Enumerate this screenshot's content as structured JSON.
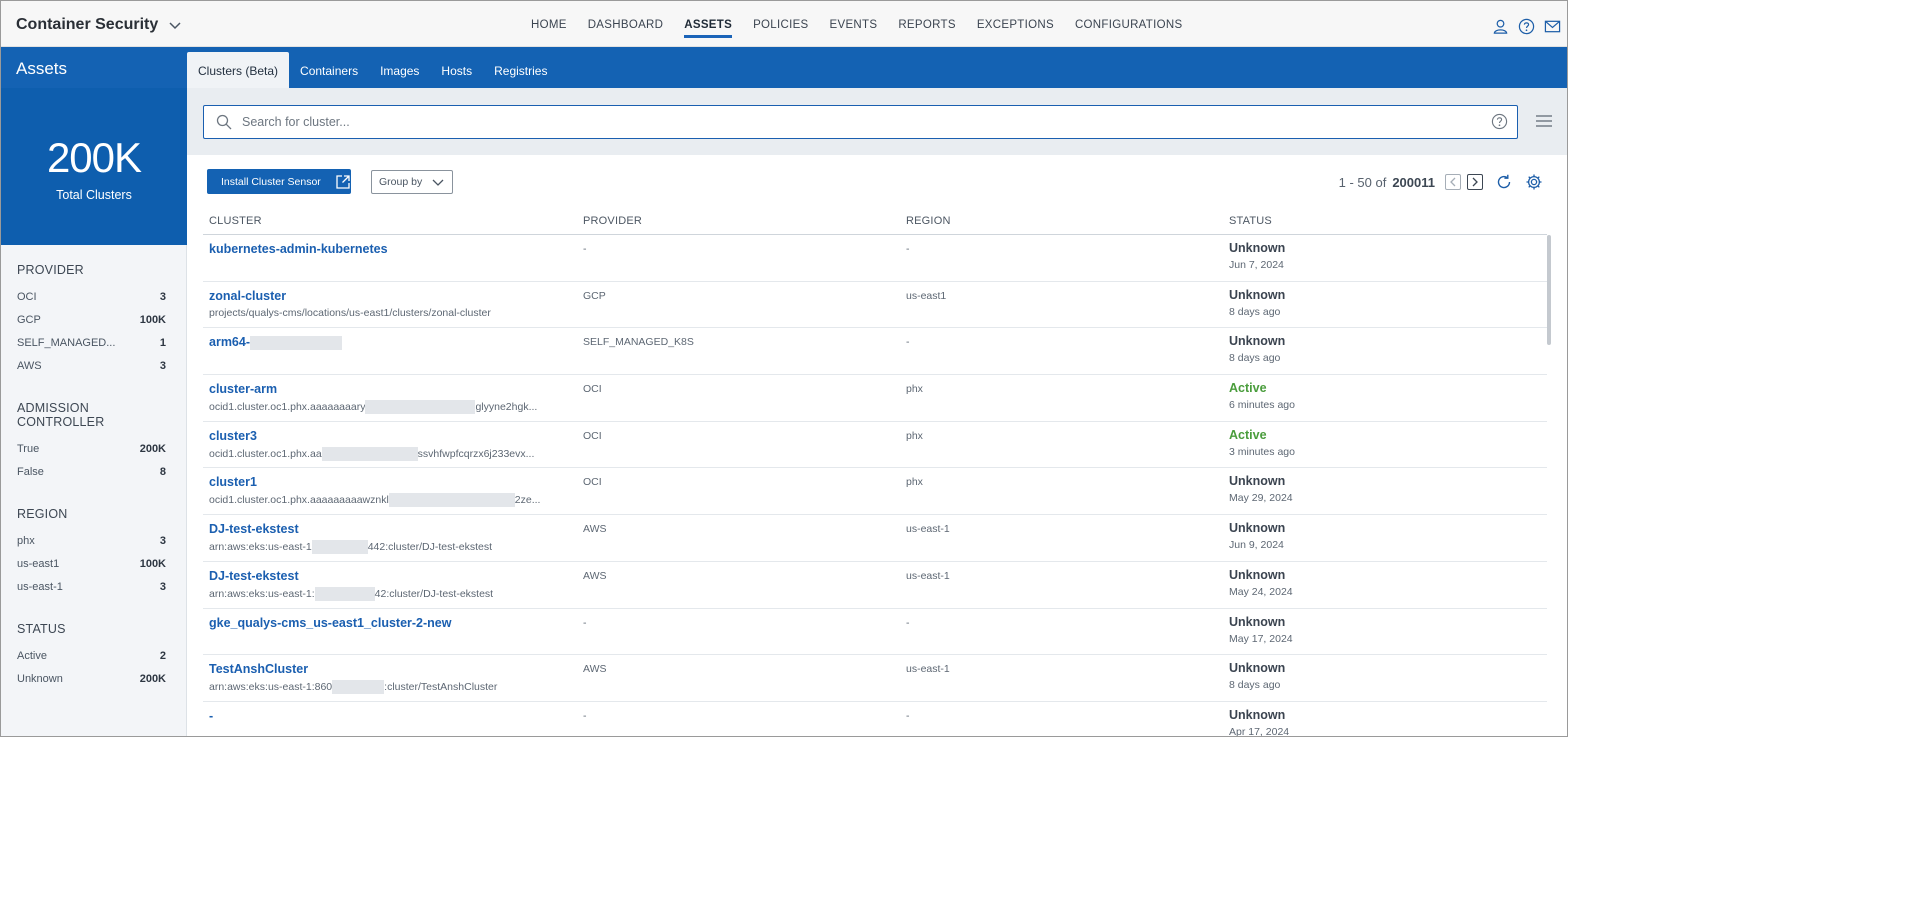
{
  "app": {
    "title": "Container Security"
  },
  "nav": {
    "items": [
      {
        "label": "HOME",
        "active": false
      },
      {
        "label": "DASHBOARD",
        "active": false
      },
      {
        "label": "ASSETS",
        "active": true
      },
      {
        "label": "POLICIES",
        "active": false
      },
      {
        "label": "EVENTS",
        "active": false
      },
      {
        "label": "REPORTS",
        "active": false
      },
      {
        "label": "EXCEPTIONS",
        "active": false
      },
      {
        "label": "CONFIGURATIONS",
        "active": false
      }
    ]
  },
  "section": {
    "title": "Assets"
  },
  "subtabs": [
    {
      "label": "Clusters (Beta)",
      "active": true
    },
    {
      "label": "Containers",
      "active": false
    },
    {
      "label": "Images",
      "active": false
    },
    {
      "label": "Hosts",
      "active": false
    },
    {
      "label": "Registries",
      "active": false
    }
  ],
  "summary": {
    "total": "200K",
    "label": "Total Clusters"
  },
  "facets": [
    {
      "title": "PROVIDER",
      "rows": [
        {
          "label": "OCI",
          "count": "3"
        },
        {
          "label": "GCP",
          "count": "100K"
        },
        {
          "label": "SELF_MANAGED...",
          "count": "1"
        },
        {
          "label": "AWS",
          "count": "3"
        }
      ]
    },
    {
      "title": "ADMISSION CONTROLLER",
      "rows": [
        {
          "label": "True",
          "count": "200K"
        },
        {
          "label": "False",
          "count": "8"
        }
      ]
    },
    {
      "title": "REGION",
      "rows": [
        {
          "label": "phx",
          "count": "3"
        },
        {
          "label": "us-east1",
          "count": "100K"
        },
        {
          "label": "us-east-1",
          "count": "3"
        }
      ]
    },
    {
      "title": "STATUS",
      "rows": [
        {
          "label": "Active",
          "count": "2"
        },
        {
          "label": "Unknown",
          "count": "200K"
        }
      ]
    }
  ],
  "search": {
    "placeholder": "Search for cluster..."
  },
  "toolbar": {
    "install_label": "Install Cluster Sensor",
    "group_label": "Group by"
  },
  "pager": {
    "range": "1 - 50 of",
    "total": "200011"
  },
  "table": {
    "columns": {
      "cluster": "CLUSTER",
      "provider": "PROVIDER",
      "region": "REGION",
      "status": "STATUS"
    },
    "rows": [
      {
        "name": "kubernetes-admin-kubernetes",
        "sub": [],
        "provider": "-",
        "region": "-",
        "status": "Unknown",
        "status_active": false,
        "time": "Jun 7, 2024"
      },
      {
        "name": "zonal-cluster",
        "sub": [
          "projects/qualys-cms/locations/us-east1/clusters/zonal-cluster"
        ],
        "provider": "GCP",
        "region": "us-east1",
        "status": "Unknown",
        "status_active": false,
        "time": "8 days ago"
      },
      {
        "name": "arm64-",
        "name_redacted": true,
        "sub": [],
        "provider": "SELF_MANAGED_K8S",
        "region": "-",
        "status": "Unknown",
        "status_active": false,
        "time": "8 days ago"
      },
      {
        "name": "cluster-arm",
        "sub": [
          "ocid1.cluster.oc1.phx.aaaaaaaary",
          "glyyne2hgk..."
        ],
        "provider": "OCI",
        "region": "phx",
        "status": "Active",
        "status_active": true,
        "time": "6 minutes ago"
      },
      {
        "name": "cluster3",
        "sub": [
          "ocid1.cluster.oc1.phx.aa",
          "ssvhfwpfcqrzx6j233evx..."
        ],
        "provider": "OCI",
        "region": "phx",
        "status": "Active",
        "status_active": true,
        "time": "3 minutes ago"
      },
      {
        "name": "cluster1",
        "sub": [
          "ocid1.cluster.oc1.phx.aaaaaaaaawznkl",
          "2ze..."
        ],
        "provider": "OCI",
        "region": "phx",
        "status": "Unknown",
        "status_active": false,
        "time": "May 29, 2024"
      },
      {
        "name": "DJ-test-ekstest",
        "sub": [
          "arn:aws:eks:us-east-1",
          "442:cluster/DJ-test-ekstest"
        ],
        "provider": "AWS",
        "region": "us-east-1",
        "status": "Unknown",
        "status_active": false,
        "time": "Jun 9, 2024"
      },
      {
        "name": "DJ-test-ekstest",
        "sub": [
          "arn:aws:eks:us-east-1:",
          "42:cluster/DJ-test-ekstest"
        ],
        "provider": "AWS",
        "region": "us-east-1",
        "status": "Unknown",
        "status_active": false,
        "time": "May 24, 2024"
      },
      {
        "name": "gke_qualys-cms_us-east1_cluster-2-new",
        "sub": [],
        "provider": "-",
        "region": "-",
        "status": "Unknown",
        "status_active": false,
        "time": "May 17, 2024"
      },
      {
        "name": "TestAnshCluster",
        "sub": [
          "arn:aws:eks:us-east-1:860",
          ":cluster/TestAnshCluster"
        ],
        "provider": "AWS",
        "region": "us-east-1",
        "status": "Unknown",
        "status_active": false,
        "time": "8 days ago"
      },
      {
        "name": "-",
        "sub": [],
        "provider": "-",
        "region": "-",
        "status": "Unknown",
        "status_active": false,
        "time": "Apr 17, 2024"
      }
    ]
  },
  "colors": {
    "brand": "#1462b3",
    "active_status": "#4a9d3c",
    "link": "#1b5fb0"
  }
}
